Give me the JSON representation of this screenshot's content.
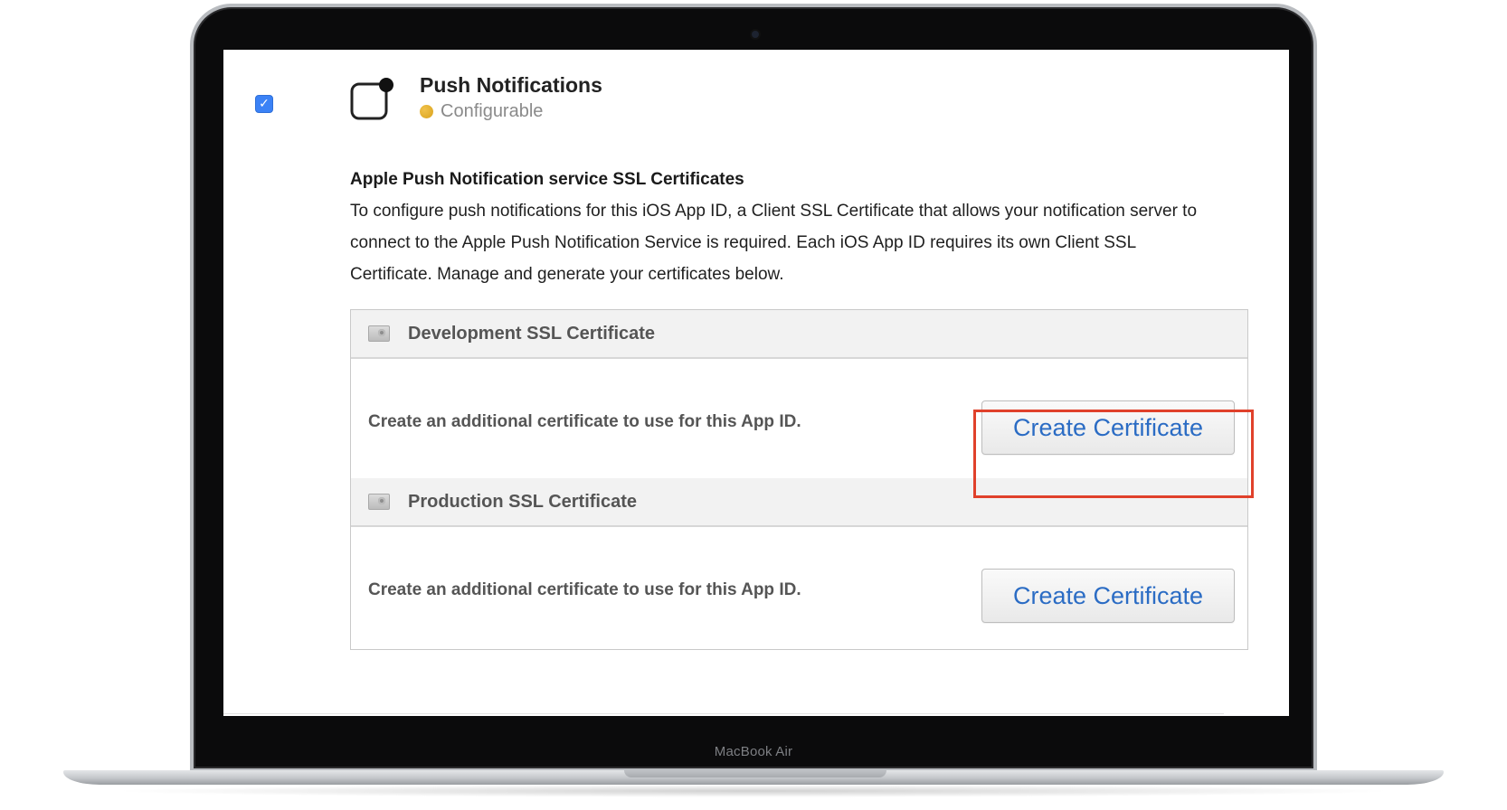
{
  "device": {
    "model_label": "MacBook Air"
  },
  "capability": {
    "enabled": true,
    "checkbox_glyph": "✓",
    "title": "Push Notifications",
    "status": "Configurable",
    "status_color": "#e0ac2d",
    "icon": "push-notification-app-icon"
  },
  "ssl_section": {
    "heading": "Apple Push Notification service SSL Certificates",
    "description": "To configure push notifications for this iOS App ID, a Client SSL Certificate that allows your notification server to connect to the Apple Push Notification Service is required. Each iOS App ID requires its own Client SSL Certificate. Manage and generate your certificates below."
  },
  "certificates": [
    {
      "title": "Development SSL Certificate",
      "message": "Create an additional certificate to use for this App ID.",
      "button_label": "Create Certificate",
      "highlighted": true
    },
    {
      "title": "Production SSL Certificate",
      "message": "Create an additional certificate to use for this App ID.",
      "button_label": "Create Certificate",
      "highlighted": false
    }
  ],
  "colors": {
    "highlight": "#e0412b",
    "button_text": "#2b6cc4",
    "checkbox": "#3b82f6"
  }
}
